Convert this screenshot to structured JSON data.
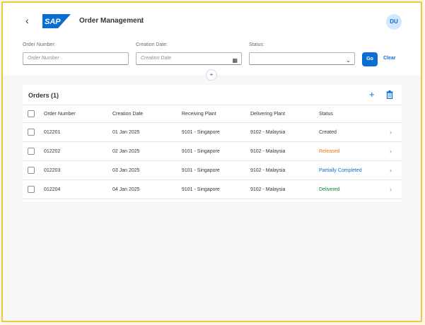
{
  "header": {
    "back_icon": "chevron-left-icon",
    "logo_text": "SAP",
    "app_title": "Order Management",
    "avatar_initials": "DU"
  },
  "filters": {
    "order_number": {
      "label": "Order Number:",
      "placeholder": "Order Number"
    },
    "creation_date": {
      "label": "Creation Date:",
      "placeholder": "Creation Date"
    },
    "status": {
      "label": "Status:",
      "value": ""
    },
    "go_label": "Go",
    "clear_label": "Clear"
  },
  "table": {
    "title": "Orders (1)",
    "columns": [
      "Order Number",
      "Creation Date",
      "Receiving Plant",
      "Delivering Plant",
      "Status"
    ],
    "rows": [
      {
        "order": "012201",
        "date": "01 Jan 2025",
        "receiving": "9101 - Singapore",
        "delivering": "9102 - Malaysia",
        "status": "Created"
      },
      {
        "order": "012202",
        "date": "02 Jan 2025",
        "receiving": "9101 - Singapore",
        "delivering": "9102 - Malaysia",
        "status": "Released"
      },
      {
        "order": "012203",
        "date": "03 Jan 2025",
        "receiving": "9101 - Singapore",
        "delivering": "9102 - Malaysia",
        "status": "Partially Completed"
      },
      {
        "order": "012204",
        "date": "04 Jan 2025",
        "receiving": "9101 - Singapore",
        "delivering": "9102 - Malaysia",
        "status": "Delivered"
      }
    ]
  },
  "colors": {
    "accent": "#0a6ed1",
    "released": "#e9730c",
    "partially_completed": "#0a6ed1",
    "delivered": "#107e3e"
  }
}
